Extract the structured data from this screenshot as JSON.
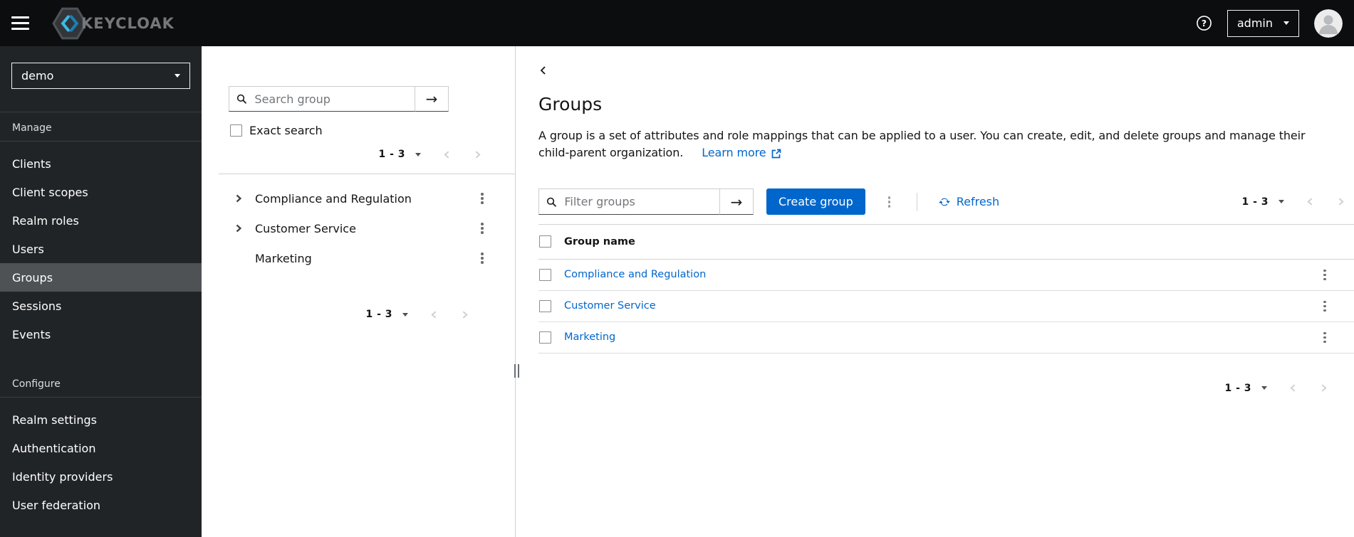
{
  "masthead": {
    "brand": "KEYCLOAK",
    "user": "admin"
  },
  "sidebar": {
    "realm": "demo",
    "sections": [
      {
        "label": "Manage",
        "items": [
          {
            "label": "Clients",
            "active": false
          },
          {
            "label": "Client scopes",
            "active": false
          },
          {
            "label": "Realm roles",
            "active": false
          },
          {
            "label": "Users",
            "active": false
          },
          {
            "label": "Groups",
            "active": true
          },
          {
            "label": "Sessions",
            "active": false
          },
          {
            "label": "Events",
            "active": false
          }
        ]
      },
      {
        "label": "Configure",
        "items": [
          {
            "label": "Realm settings",
            "active": false
          },
          {
            "label": "Authentication",
            "active": false
          },
          {
            "label": "Identity providers",
            "active": false
          },
          {
            "label": "User federation",
            "active": false
          }
        ]
      }
    ]
  },
  "tree_panel": {
    "search_placeholder": "Search group",
    "exact_search_label": "Exact search",
    "pagination_top": "1 - 3",
    "pagination_bottom": "1 - 3",
    "groups": [
      {
        "name": "Compliance and Regulation",
        "expandable": true
      },
      {
        "name": "Customer Service",
        "expandable": true
      },
      {
        "name": "Marketing",
        "expandable": false
      }
    ]
  },
  "main": {
    "title": "Groups",
    "description_line1": "A group is a set of attributes and role mappings that can be applied to a user. You can create, edit, and delete groups and manage their",
    "description_line2": "child-parent organization.",
    "learn_more_label": "Learn more",
    "toolbar": {
      "filter_placeholder": "Filter groups",
      "create_button_label": "Create group",
      "refresh_label": "Refresh",
      "pagination": "1 - 3"
    },
    "table": {
      "column_header": "Group name",
      "rows": [
        {
          "name": "Compliance and Regulation"
        },
        {
          "name": "Customer Service"
        },
        {
          "name": "Marketing"
        }
      ]
    },
    "bottom_pagination": "1 - 3"
  },
  "icons": {
    "hamburger": "menu",
    "help": "question-circle",
    "user_caret": "caret-down",
    "avatar": "user-silhouette",
    "search": "magnifier",
    "search_submit": "arrow-right",
    "kebab": "ellipsis-v",
    "refresh": "sync",
    "learn_more": "external-link",
    "back": "chevron-left",
    "expand": "chevron-right",
    "pagination_prev": "chevron-left",
    "pagination_next": "chevron-right"
  },
  "colors": {
    "masthead_bg": "#0b0d0f",
    "sidebar_bg": "#212427",
    "sidebar_active_bg": "#4f5255",
    "accent": "#0066cc",
    "link": "#0066cc",
    "border": "#d2d2d2",
    "text": "#151515",
    "logo_blue_light": "#3fb9e6",
    "logo_blue_dark": "#1a7fb4"
  }
}
